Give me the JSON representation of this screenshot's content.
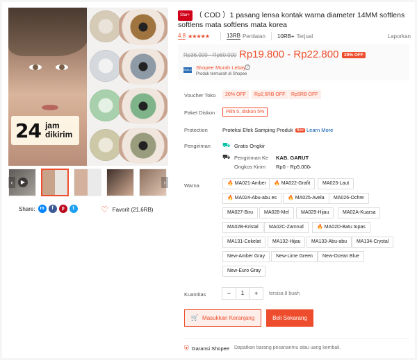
{
  "gallery": {
    "badge_number": "24",
    "badge_text": "jam dikirim",
    "lens_colors": [
      "#b98a5a",
      "#8e9aa6",
      "#7fb48a",
      "#9a9c7e"
    ]
  },
  "share": {
    "label": "Share:",
    "icons": [
      "messenger-icon",
      "facebook-icon",
      "pinterest-icon",
      "twitter-icon"
    ]
  },
  "favorite": {
    "label": "Favorit (21,6RB)"
  },
  "product": {
    "star_badge": "Star+",
    "title": "（ COD ）1 pasang lensa kontak warna diameter 14MM softlens softlens mata softlens mata korea"
  },
  "stats": {
    "rating": "4.8",
    "stars": "★★★★★",
    "reviews_count": "13RB",
    "reviews_label": "Penilaian",
    "sold_count": "10RB+",
    "sold_label": "Terjual",
    "report": "Laporkan"
  },
  "price": {
    "old": "Rp36.000 - Rp60.000",
    "new": "Rp19.800 - Rp22.800",
    "discount": "29% OFF",
    "seller_logo": "SMILE",
    "seller_name": "Shopee Murah Lebay",
    "seller_sub": "Produk termurah di Shopee"
  },
  "voucher": {
    "label": "Voucher Toko",
    "items": [
      "20% OFF",
      "Rp2,5RB OFF",
      "Rp5RB OFF"
    ]
  },
  "bundle": {
    "label": "Paket Diskon",
    "value": "Pilih 5, diskon 5%"
  },
  "protection": {
    "label": "Protection",
    "value": "Proteksi Efek Samping Produk",
    "new_tag": "New",
    "link": "Learn More"
  },
  "shipping": {
    "label": "Pengiriman",
    "free": "Gratis Ongkir",
    "to_label": "Pengiriman Ke",
    "to_value": "KAB. GARUT",
    "cost_label": "Ongkos Kirim",
    "cost_value": "Rp0 - Rp5.000"
  },
  "colors": {
    "label": "Warna",
    "options": [
      "MA021-Amber",
      "MA022-Grafit",
      "MA023-Laut",
      "MA024-Abu-abu es",
      "MA025-Avela",
      "MA026-Ochre",
      "MA027-Biru",
      "MA028-Mel",
      "MA029-Hijau",
      "MA02A-Kuarsa",
      "MA02B-Kristal",
      "MA02C-Zamrud",
      "MA02D-Batu topas",
      "MA131-Cokelat",
      "MA132-Hijau",
      "MA133-Abu-abu",
      "MA134-Crystal",
      "New-Amber Gray",
      "New-Lime Green",
      "New-Ocean Blue",
      "New-Euro Gray"
    ]
  },
  "quantity": {
    "label": "Kuantitas",
    "minus": "−",
    "value": "1",
    "plus": "+",
    "stock": "tersisa 8 buah"
  },
  "actions": {
    "cart": "Masukkan Keranjang",
    "buy": "Beli Sekarang"
  },
  "guarantee": {
    "label": "Garansi Shopee",
    "sub": "Dapatkan barang pesananmu atau uang kembali."
  }
}
